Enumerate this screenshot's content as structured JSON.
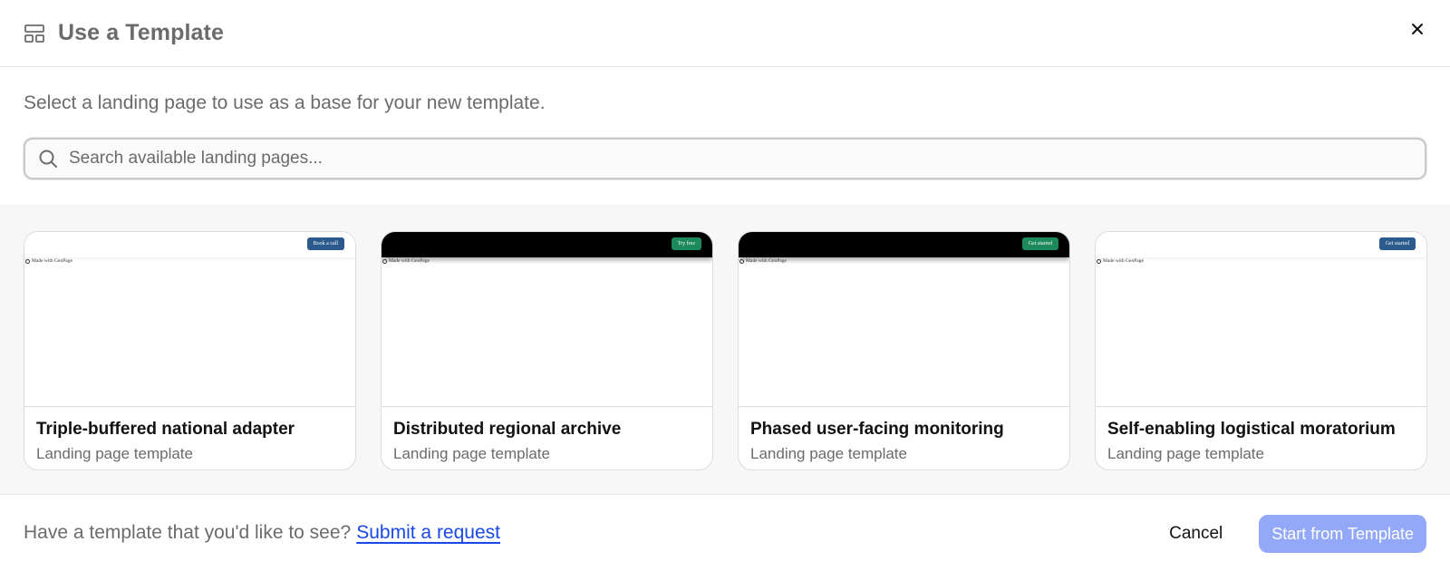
{
  "dialog": {
    "title": "Use a Template",
    "subtitle": "Select a landing page to use as a base for your new template.",
    "search": {
      "placeholder": "Search available landing pages..."
    }
  },
  "templates": [
    {
      "title": "Triple-buffered national adapter",
      "subtitle": "Landing page template",
      "preview_theme": "light",
      "preview_button": "Book a call",
      "preview_button_color": "#2b5a8c",
      "made_with": "Made with GenPage"
    },
    {
      "title": "Distributed regional archive",
      "subtitle": "Landing page template",
      "preview_theme": "dark",
      "preview_button": "Try free",
      "preview_button_color": "#1c8a5a",
      "made_with": "Made with GenPage"
    },
    {
      "title": "Phased user-facing monitoring",
      "subtitle": "Landing page template",
      "preview_theme": "dark",
      "preview_button": "Get started",
      "preview_button_color": "#1c8a5a",
      "made_with": "Made with GenPage"
    },
    {
      "title": "Self-enabling logistical moratorium",
      "subtitle": "Landing page template",
      "preview_theme": "light",
      "preview_button": "Get started",
      "preview_button_color": "#2b5a8c",
      "made_with": "Made with GenPage"
    }
  ],
  "footer": {
    "prompt": "Have a template that you'd like to see?",
    "link": "Submit a request",
    "cancel": "Cancel",
    "start": "Start from Template"
  },
  "colors": {
    "accent_link": "#1a47e8",
    "primary_disabled": "#93a8f8"
  }
}
